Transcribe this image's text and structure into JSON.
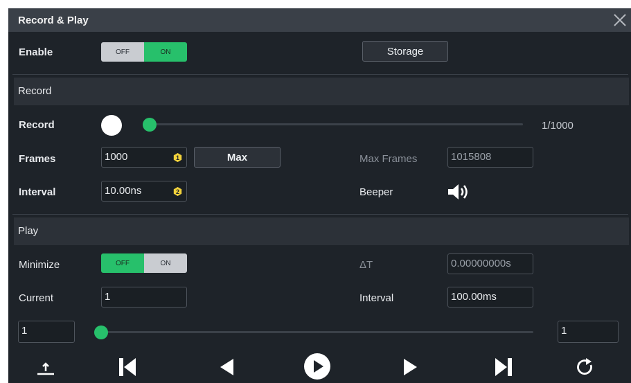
{
  "dialog": {
    "title": "Record & Play"
  },
  "enable": {
    "label": "Enable",
    "off": "OFF",
    "on": "ON"
  },
  "storage_button": "Storage",
  "record_section": {
    "heading": "Record",
    "record_label": "Record",
    "frame_count": "1/1000",
    "slider_fraction": 0.0,
    "frames_label": "Frames",
    "frames_value": "1000",
    "max_button": "Max",
    "max_frames_label": "Max Frames",
    "max_frames_value": "1015808",
    "interval_label": "Interval",
    "interval_value": "10.00ns",
    "beeper_label": "Beeper"
  },
  "play_section": {
    "heading": "Play",
    "minimize_label": "Minimize",
    "minimize_off": "OFF",
    "minimize_on": "ON",
    "delta_t_label": "ΔT",
    "delta_t_value": "0.00000000s",
    "current_label": "Current",
    "current_value": "1",
    "interval_label": "Interval",
    "interval_value": "100.00ms",
    "range_start": "1",
    "range_end": "1",
    "slider_fraction": 0.0
  },
  "icons": {
    "close": "close-icon",
    "badge1": "badge-1-icon",
    "badge2": "badge-2-icon",
    "beeper": "speaker-icon",
    "controls": [
      "export-icon",
      "skip-first-icon",
      "play-reverse-icon",
      "play-icon",
      "play-forward-icon",
      "skip-last-icon",
      "repeat-icon"
    ]
  },
  "colors": {
    "accent": "#27c06b",
    "badge": "#f2d23c",
    "panel": "#1e2329"
  }
}
